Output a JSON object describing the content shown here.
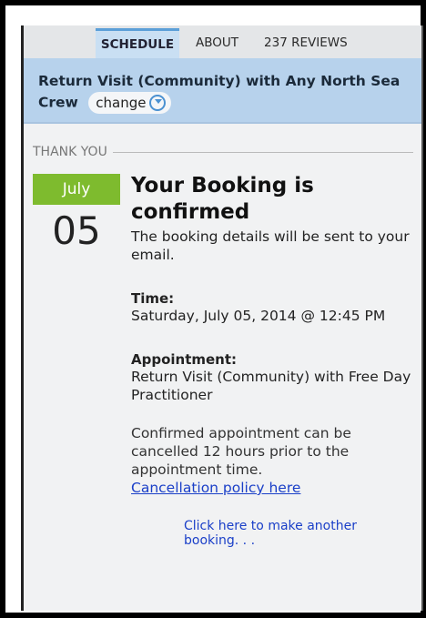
{
  "tabs": {
    "schedule": "SCHEDULE",
    "about": "ABOUT",
    "reviews": "237 REVIEWS"
  },
  "header": {
    "title": "Return Visit (Community) with Any North Sea Crew",
    "change_label": "change"
  },
  "section": {
    "heading": "THANK YOU"
  },
  "date": {
    "month": "July",
    "day": "05"
  },
  "confirmation": {
    "title": "Your Booking is confirmed",
    "subtitle": "The booking details will be sent to your email.",
    "time_label": "Time:",
    "time_value": "Saturday, July 05, 2014 @ 12:45 PM",
    "appointment_label": "Appointment:",
    "appointment_value": "Return Visit (Community) with Free Day Practitioner",
    "cancel_note": "Confirmed appointment can be cancelled 12 hours prior to the appointment time.",
    "cancel_link": "Cancellation policy here"
  },
  "another_booking": "Click here to make another booking. . .",
  "colors": {
    "accent_green": "#7ebb2e",
    "header_blue": "#b7d2ec",
    "link_blue": "#1a3fc8"
  }
}
